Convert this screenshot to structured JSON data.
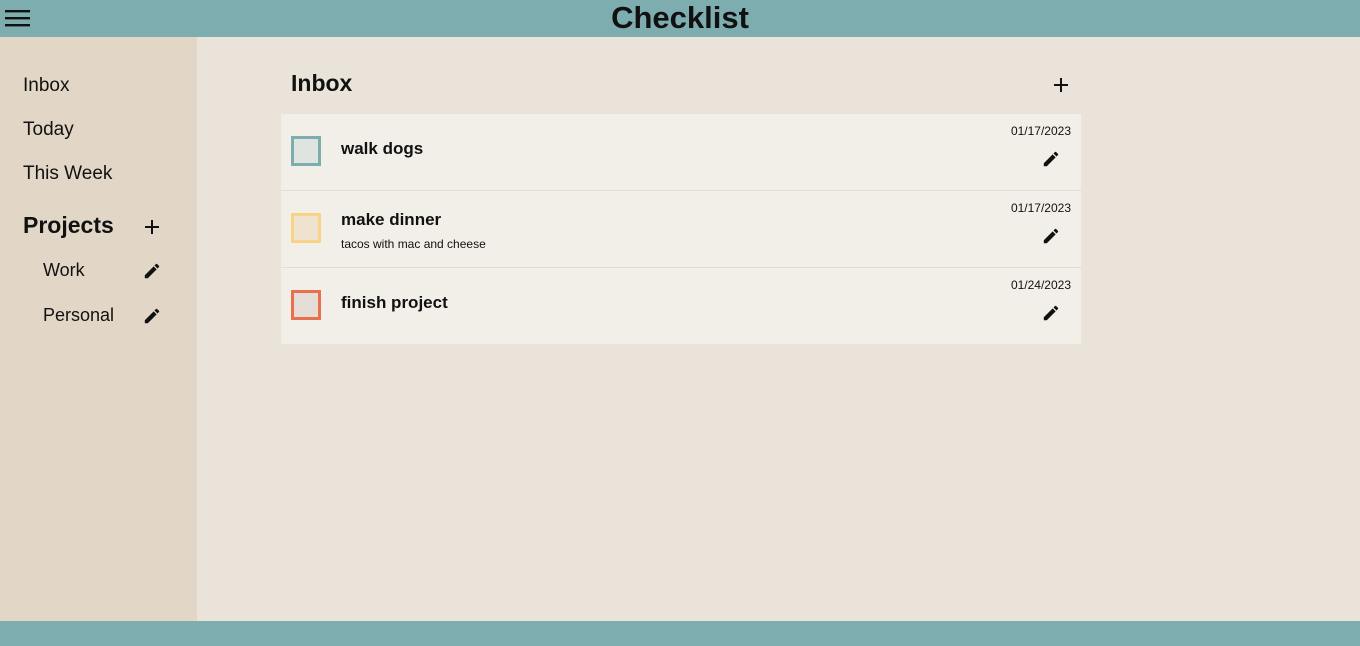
{
  "app": {
    "title": "Checklist",
    "menu_icon": "hamburger-menu-icon",
    "colors": {
      "header": "#7eadb0",
      "sidebar": "#e2d7c7",
      "main": "#eae3da",
      "task_card": "#f2eee8"
    }
  },
  "sidebar": {
    "nav": [
      {
        "label": "Inbox"
      },
      {
        "label": "Today"
      },
      {
        "label": "This Week"
      }
    ],
    "projects_title": "Projects",
    "add_project_icon": "plus-icon",
    "projects": [
      {
        "label": "Work",
        "icon": "pencil-icon"
      },
      {
        "label": "Personal",
        "icon": "pencil-icon"
      }
    ]
  },
  "main": {
    "title": "Inbox",
    "add_task_icon": "plus-icon",
    "tasks": [
      {
        "title": "walk dogs",
        "description": "",
        "date": "01/17/2023",
        "priority_color": "#7eadb0",
        "checkbox_fill": "#dfe4e0",
        "completed": false
      },
      {
        "title": "make dinner",
        "description": "tacos with mac and cheese",
        "date": "01/17/2023",
        "priority_color": "#f7d488",
        "checkbox_fill": "#efe2cf",
        "completed": false
      },
      {
        "title": "finish project",
        "description": "",
        "date": "01/24/2023",
        "priority_color": "#e8704f",
        "checkbox_fill": "#e5ddd5",
        "completed": false
      }
    ]
  }
}
